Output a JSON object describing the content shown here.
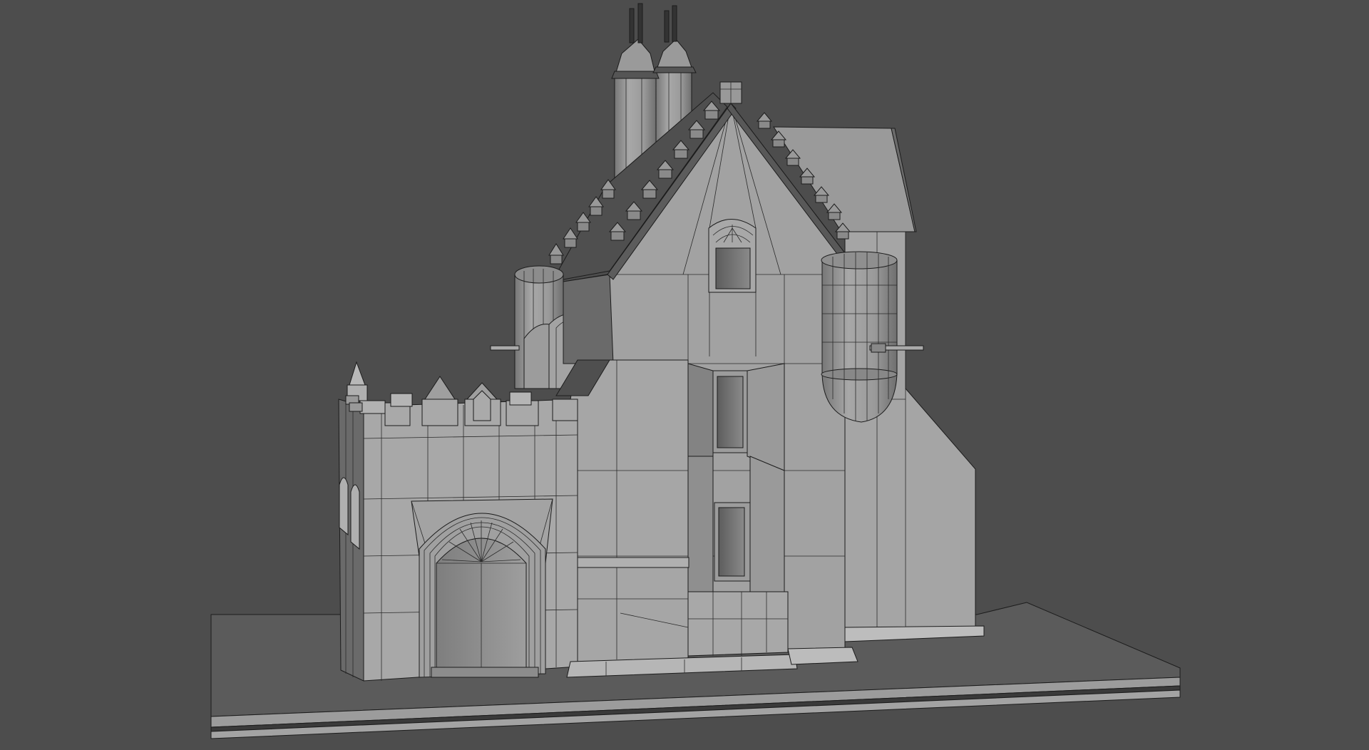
{
  "viewport": {
    "background": "#4d4d4d",
    "render_mode": "shaded-wireframe",
    "subject": "gothic-house-model"
  },
  "colors": {
    "wall_light": "#a6a6a6",
    "wall_mid": "#989898",
    "wall_shade": "#8a8a8a",
    "roof_dark": "#555555",
    "roof_light": "#9c9c9c",
    "window_dark": "#6e6e6e",
    "base_top": "#5e5e5e",
    "base_edge": "#9a9a9a",
    "edge": "#1c1c1c"
  }
}
